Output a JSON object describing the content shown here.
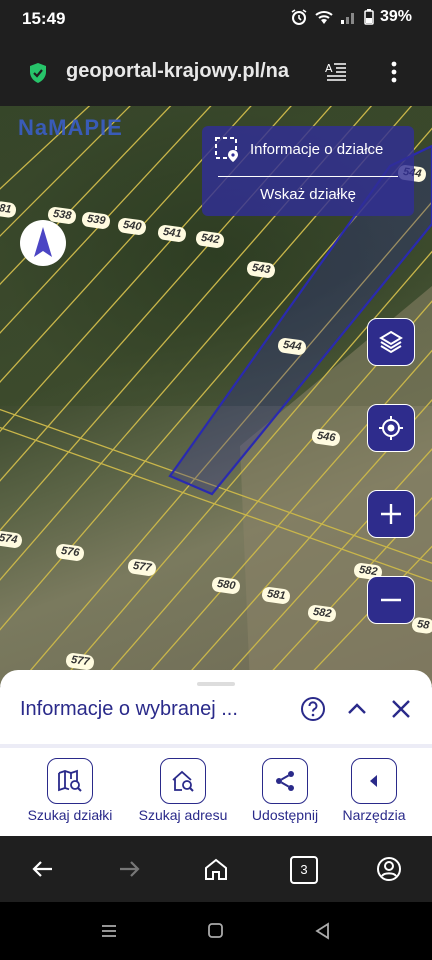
{
  "status": {
    "time": "15:49",
    "battery": "39%"
  },
  "browser": {
    "url": "geoportal-krajowy.pl/na",
    "tab_count": "3"
  },
  "map": {
    "logo": "NaMAPIE",
    "info_panel": {
      "title": "Informacje o działce",
      "action": "Wskaż działkę"
    },
    "plot_labels": [
      {
        "text": "81"
      },
      {
        "text": "538"
      },
      {
        "text": "539"
      },
      {
        "text": "540"
      },
      {
        "text": "541"
      },
      {
        "text": "542"
      },
      {
        "text": "543"
      },
      {
        "text": "544"
      },
      {
        "text": "546"
      },
      {
        "text": "574"
      },
      {
        "text": "576"
      },
      {
        "text": "577"
      },
      {
        "text": "580"
      },
      {
        "text": "581"
      },
      {
        "text": "582"
      },
      {
        "text": "582"
      },
      {
        "text": "58"
      },
      {
        "text": "577"
      },
      {
        "text": "544"
      }
    ],
    "buttons": [
      "layers-icon",
      "locate-icon",
      "zoom-in-icon",
      "zoom-out-icon"
    ]
  },
  "sheet": {
    "title": "Informacje o wybranej ...",
    "tools": [
      {
        "label": "Szukaj działki"
      },
      {
        "label": "Szukaj adresu"
      },
      {
        "label": "Udostępnij"
      },
      {
        "label": "Narzędzia"
      }
    ]
  },
  "colors": {
    "accent": "#2a2a8a",
    "panel": "#312e96",
    "plot_line": "#c9b64a"
  }
}
